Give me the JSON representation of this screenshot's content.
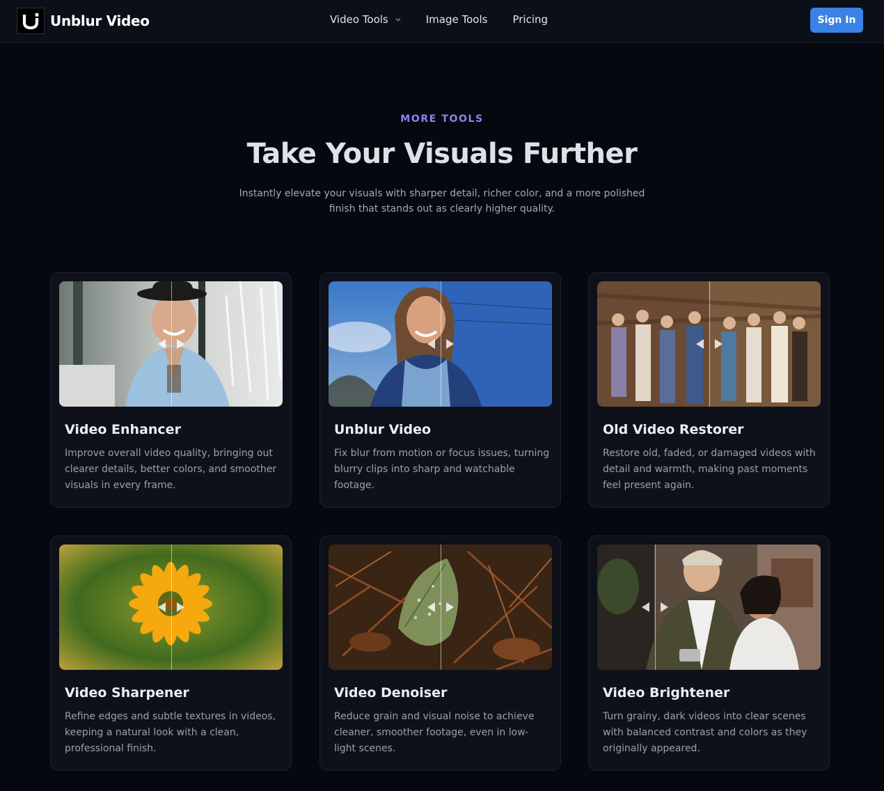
{
  "header": {
    "brand_name": "Unblur Video",
    "nav": [
      {
        "label": "Video Tools",
        "has_dropdown": true
      },
      {
        "label": "Image Tools",
        "has_dropdown": false
      },
      {
        "label": "Pricing",
        "has_dropdown": false
      }
    ],
    "signin_label": "Sign In"
  },
  "hero": {
    "eyebrow": "MORE TOOLS",
    "title": "Take Your Visuals Further",
    "subtitle_line1": "Instantly elevate your visuals with sharper detail, richer color, and a more polished",
    "subtitle_line2": "finish that stands out as clearly higher quality."
  },
  "cards": [
    {
      "title": "Video Enhancer",
      "desc": "Improve overall video quality, bringing out clearer details, better colors, and smoother visuals in every frame."
    },
    {
      "title": "Unblur Video",
      "desc": "Fix blur from motion or focus issues, turning blurry clips into sharp and watchable footage."
    },
    {
      "title": "Old Video Restorer",
      "desc": "Restore old, faded, or damaged videos with detail and warmth, making past moments feel present again."
    },
    {
      "title": "Video Sharpener",
      "desc": "Refine edges and subtle textures in videos, keeping a natural look with a clean, professional finish."
    },
    {
      "title": "Video Denoiser",
      "desc": "Reduce grain and visual noise to achieve cleaner, smoother footage, even in low-light scenes."
    },
    {
      "title": "Video Brightener",
      "desc": "Turn grainy, dark videos into clear scenes with balanced contrast and colors as they originally appeared."
    }
  ],
  "colors": {
    "background": "#06080f",
    "accent": "#8e82f0",
    "button": "#3b82e6",
    "card": "#0e111a"
  }
}
